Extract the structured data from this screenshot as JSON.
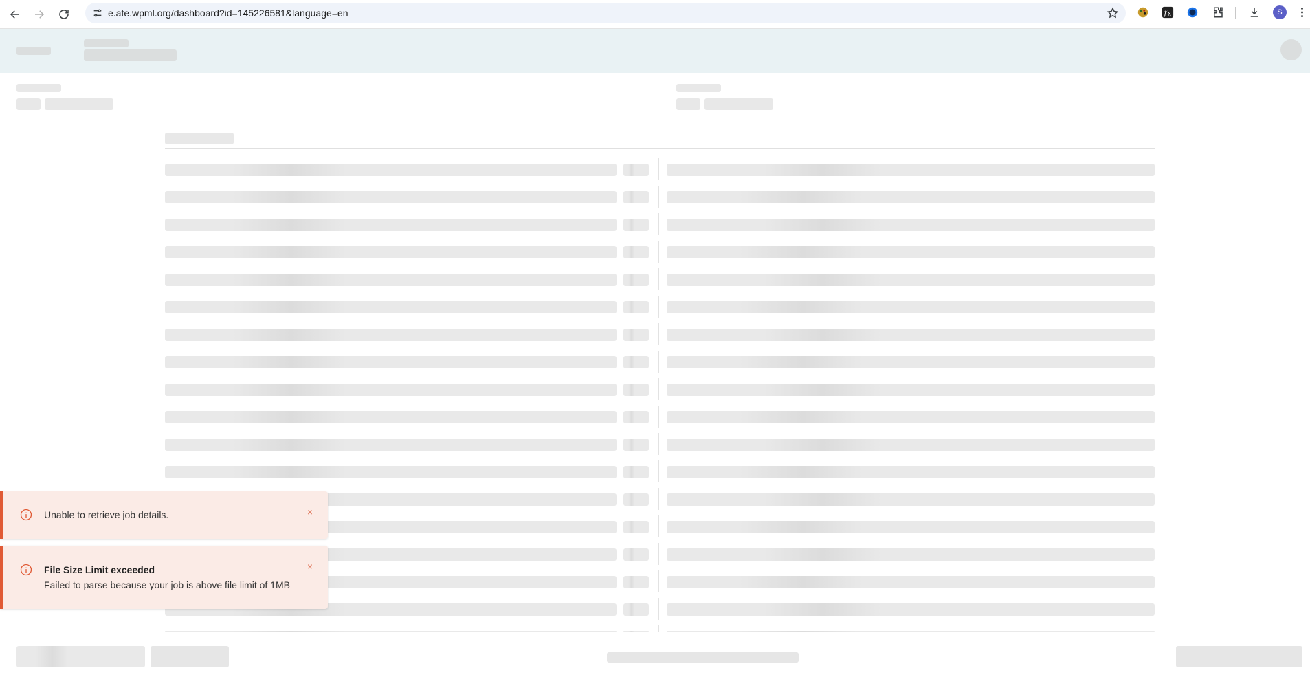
{
  "browser": {
    "url": "e.ate.wpml.org/dashboard?id=145226581&language=en",
    "profile_initial": "S",
    "icons": [
      "back-icon",
      "forward-icon",
      "reload-icon",
      "site-info-icon",
      "bookmark-star-icon",
      "extension-icon",
      "downloads-icon",
      "menu-icon"
    ]
  },
  "toasts": [
    {
      "title": "Unable to retrieve job details.",
      "message": "",
      "close": "×"
    },
    {
      "title": "File Size Limit exceeded",
      "message": "Failed to parse because your job is above file limit of 1MB",
      "close": "×"
    }
  ],
  "colors": {
    "header_bg": "#e9f2f4",
    "toast_bg": "#fbebe6",
    "toast_accent": "#e05a35",
    "skeleton": "#e9e9e9"
  }
}
